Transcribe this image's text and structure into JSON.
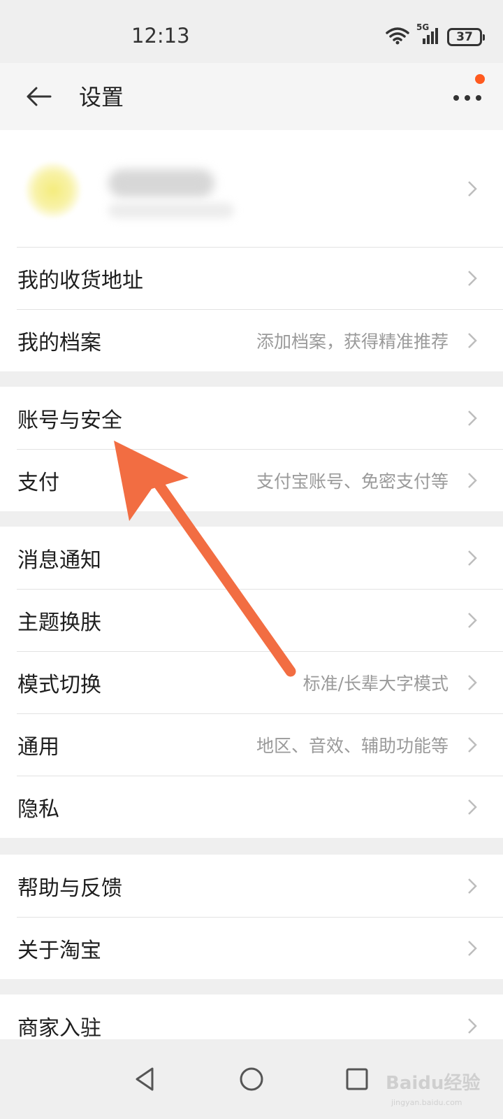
{
  "status": {
    "time": "12:13",
    "battery": "37",
    "network": "5G",
    "icons": [
      "wifi-icon",
      "signal-icon",
      "battery-icon"
    ]
  },
  "header": {
    "title": "设置",
    "back_icon": "back-arrow-icon",
    "more_icon": "more-dots-icon",
    "notification_dot_color": "#ff5a1f"
  },
  "groups": [
    {
      "items": [
        {
          "label": "我的收货地址",
          "sub": ""
        },
        {
          "label": "我的档案",
          "sub": "添加档案，获得精准推荐"
        }
      ]
    },
    {
      "items": [
        {
          "label": "账号与安全",
          "sub": ""
        },
        {
          "label": "支付",
          "sub": "支付宝账号、免密支付等"
        }
      ]
    },
    {
      "items": [
        {
          "label": "消息通知",
          "sub": ""
        },
        {
          "label": "主题换肤",
          "sub": ""
        },
        {
          "label": "模式切换",
          "sub": "标准/长辈大字模式"
        },
        {
          "label": "通用",
          "sub": "地区、音效、辅助功能等"
        },
        {
          "label": "隐私",
          "sub": ""
        }
      ]
    },
    {
      "items": [
        {
          "label": "帮助与反馈",
          "sub": ""
        },
        {
          "label": "关于淘宝",
          "sub": ""
        }
      ]
    },
    {
      "items": [
        {
          "label": "商家入驻",
          "sub": ""
        }
      ]
    }
  ],
  "annotation": {
    "arrow_color": "#f26d42",
    "points_to": "账号与安全"
  },
  "system_nav": {
    "icons": [
      "back-triangle-icon",
      "home-circle-icon",
      "recent-square-icon"
    ]
  },
  "watermark": {
    "text": "Baidu经验",
    "url": "jingyan.baidu.com"
  },
  "colors": {
    "accent": "#ff5a1f",
    "background": "#efefef",
    "secondary_text": "#9a9a9a"
  }
}
